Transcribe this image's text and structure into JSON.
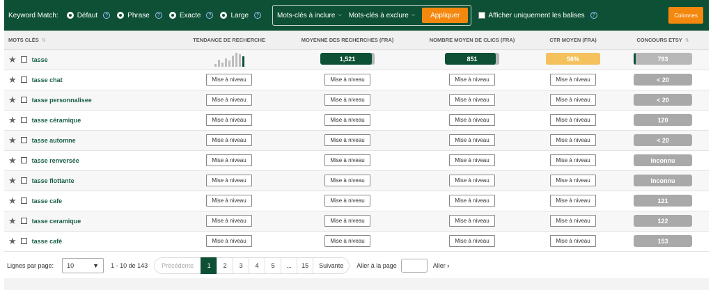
{
  "topbar": {
    "keyword_match_label": "Keyword Match:",
    "options": [
      {
        "label": "Défaut",
        "selected": true
      },
      {
        "label": "Phrase",
        "selected": false
      },
      {
        "label": "Exacte",
        "selected": false
      },
      {
        "label": "Large",
        "selected": false
      }
    ],
    "include_label": "Mots-clés à inclure",
    "exclude_label": "Mots-clés à exclure",
    "apply_label": "Appliquer",
    "tags_only_label": "Afficher uniquement les balises",
    "columns_label": "Colonnes"
  },
  "table": {
    "headers": {
      "keywords": "MOTS CLÉS",
      "trend": "TENDANCE DE RECHERCHE",
      "avg_searches": "MOYENNE DES RECHERCHES (FRA)",
      "avg_clicks": "NOMBRE MOYEN DE CLICS (FRA)",
      "ctr": "CTR MOYEN (FRA)",
      "competition": "CONCOURS ETSY"
    },
    "upgrade_label": "Mise à niveau",
    "first_row": {
      "keyword": "tasse",
      "searches": "1,521",
      "searches_level": 0.95,
      "clicks": "851",
      "clicks_level": 0.93,
      "ctr": "56%",
      "ctr_level": 1.0,
      "competition": "793",
      "competition_level": 0.03,
      "trend_levels": [
        0.2,
        0.5,
        0.3,
        0.6,
        0.45,
        0.8,
        1.0,
        0.9,
        0.75
      ]
    },
    "rows": [
      {
        "keyword": "tasse chat",
        "competition": "< 20"
      },
      {
        "keyword": "tasse personnalisee",
        "competition": "< 20"
      },
      {
        "keyword": "tasse céramique",
        "competition": "120"
      },
      {
        "keyword": "tasse automne",
        "competition": "< 20"
      },
      {
        "keyword": "tasse renversée",
        "competition": "Inconnu"
      },
      {
        "keyword": "tasse flottante",
        "competition": "Inconnu"
      },
      {
        "keyword": "tasse cafe",
        "competition": "121"
      },
      {
        "keyword": "tasse ceramique",
        "competition": "122"
      },
      {
        "keyword": "tasse café",
        "competition": "153"
      }
    ]
  },
  "footer": {
    "rows_per_page_label": "Lignes par page:",
    "rows_per_page_value": "10",
    "range_text": "1 - 10 de 143",
    "prev_label": "Précédente",
    "pages": [
      "1",
      "2",
      "3",
      "4",
      "5",
      "...",
      "15"
    ],
    "active_page": "1",
    "next_label": "Suivante",
    "goto_label": "Aller à la page",
    "go_label": "Aller"
  },
  "colors": {
    "brand_green": "#0d5035",
    "orange": "#f4870d",
    "ctr_yellow": "#f5c15d",
    "bar_gray": "#b8b8b8"
  }
}
